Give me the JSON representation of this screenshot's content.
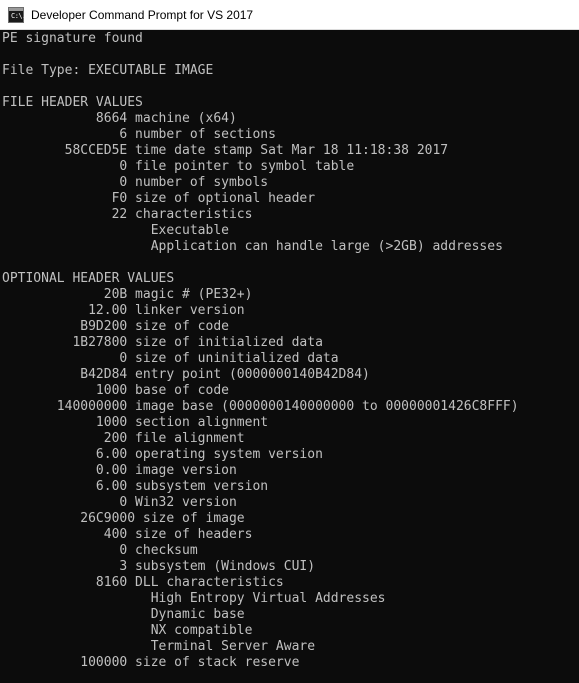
{
  "window": {
    "title": "Developer Command Prompt for VS 2017",
    "icon": "console-icon",
    "icon_glyph": "C:\\."
  },
  "console": {
    "text_color": "#c0c0c0",
    "background_color": "#0c0c0c",
    "lines": [
      "PE signature found",
      "",
      "File Type: EXECUTABLE IMAGE",
      "",
      "FILE HEADER VALUES",
      "            8664 machine (x64)",
      "               6 number of sections",
      "        58CCED5E time date stamp Sat Mar 18 11:18:38 2017",
      "               0 file pointer to symbol table",
      "               0 number of symbols",
      "              F0 size of optional header",
      "              22 characteristics",
      "                   Executable",
      "                   Application can handle large (>2GB) addresses",
      "",
      "OPTIONAL HEADER VALUES",
      "             20B magic # (PE32+)",
      "           12.00 linker version",
      "          B9D200 size of code",
      "         1B27800 size of initialized data",
      "               0 size of uninitialized data",
      "          B42D84 entry point (0000000140B42D84)",
      "            1000 base of code",
      "       140000000 image base (0000000140000000 to 00000001426C8FFF)",
      "            1000 section alignment",
      "             200 file alignment",
      "            6.00 operating system version",
      "            0.00 image version",
      "            6.00 subsystem version",
      "               0 Win32 version",
      "          26C9000 size of image",
      "             400 size of headers",
      "               0 checksum",
      "               3 subsystem (Windows CUI)",
      "            8160 DLL characteristics",
      "                   High Entropy Virtual Addresses",
      "                   Dynamic base",
      "                   NX compatible",
      "                   Terminal Server Aware",
      "          100000 size of stack reserve"
    ]
  }
}
